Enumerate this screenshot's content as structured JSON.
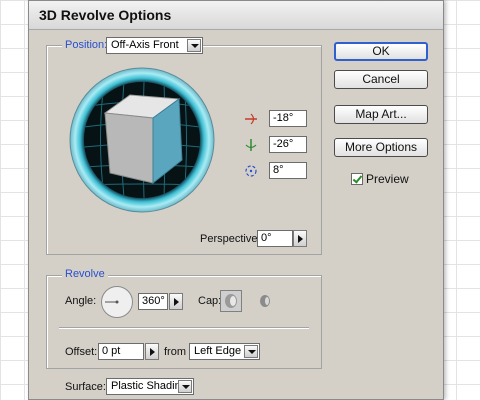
{
  "dialog": {
    "title": "3D Revolve Options",
    "position": {
      "legend": "Position:",
      "preset": "Off-Axis Front",
      "rotations": [
        {
          "icon": "x-axis-rotation-icon",
          "value": "-18°"
        },
        {
          "icon": "y-axis-rotation-icon",
          "value": "-26°"
        },
        {
          "icon": "z-axis-rotation-icon",
          "value": "8°"
        }
      ],
      "perspective_label": "Perspective:",
      "perspective_value": "0°"
    },
    "revolve": {
      "legend": "Revolve",
      "angle_label": "Angle:",
      "angle_value": "360°",
      "cap_label": "Cap:",
      "offset_label": "Offset:",
      "offset_value": "0 pt",
      "from_label": "from",
      "from_value": "Left Edge"
    },
    "surface": {
      "label": "Surface:",
      "value": "Plastic Shading"
    },
    "buttons": {
      "ok": "OK",
      "cancel": "Cancel",
      "map_art": "Map Art...",
      "more_options": "More Options"
    },
    "preview": {
      "label": "Preview",
      "checked": true
    }
  },
  "colors": {
    "dialog_bg": "#d4d0c8",
    "accent_blue": "#2a4fcf",
    "cube_front": "#5aa6bf",
    "ring_teal": "#7fd6e6"
  }
}
